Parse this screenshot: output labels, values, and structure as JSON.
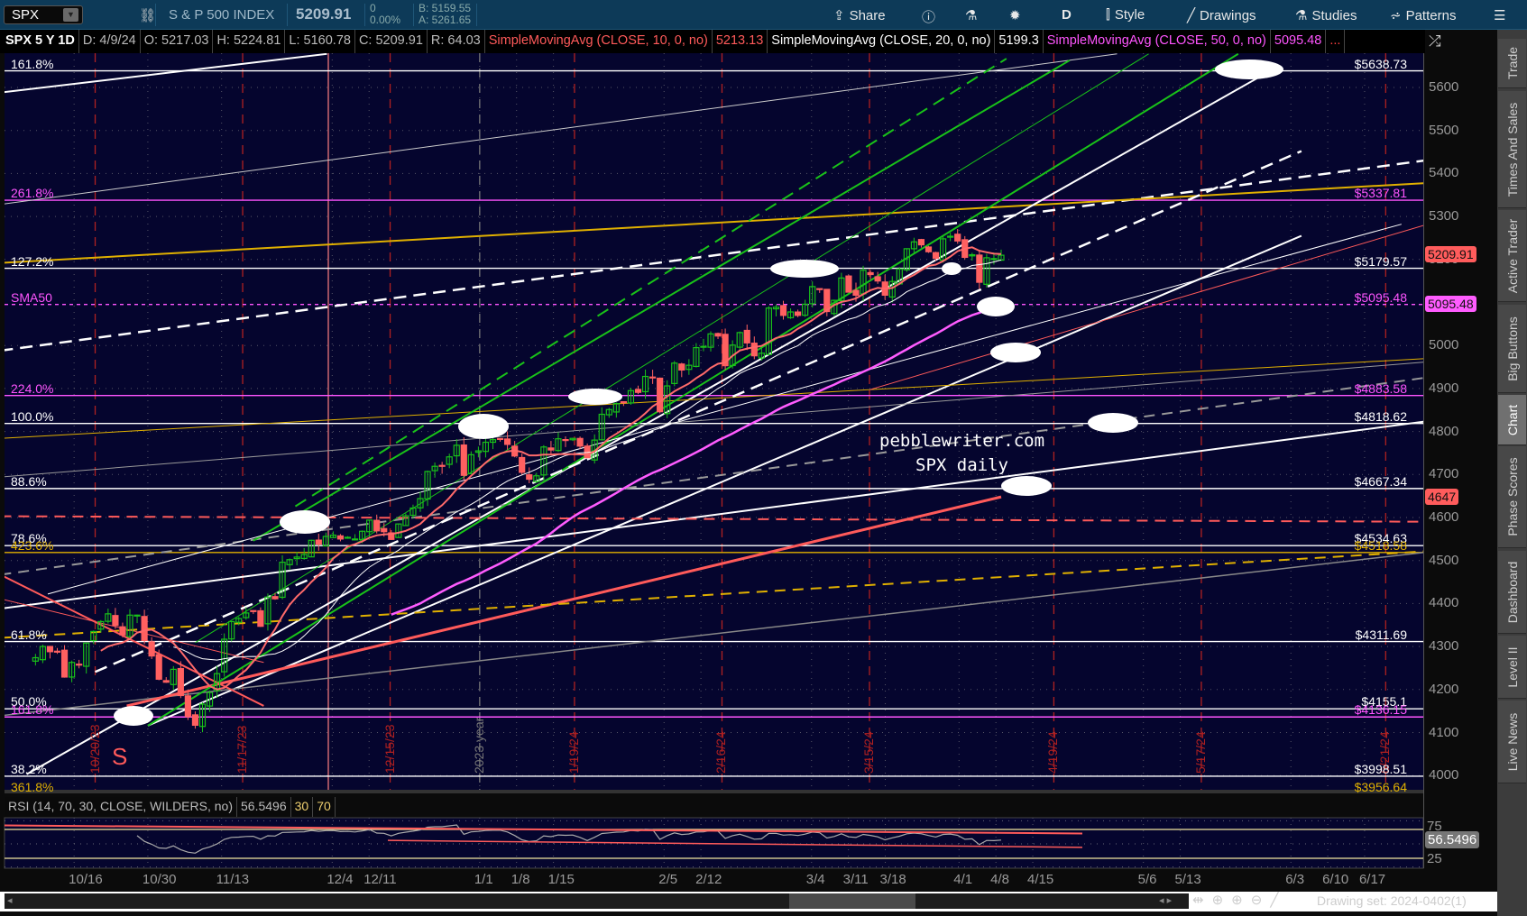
{
  "toolbar": {
    "symbol": "SPX",
    "description": "S & P 500 INDEX",
    "last": "5209.91",
    "change": "0",
    "change_pct": "0.00%",
    "bid": "B: 5159.55",
    "ask": "A: 5261.65",
    "share": "Share",
    "period": "D",
    "style": "Style",
    "drawings": "Drawings",
    "studies": "Studies",
    "patterns": "Patterns"
  },
  "info": {
    "title": "SPX 5 Y 1D",
    "date": "D: 4/9/24",
    "open": "O: 5217.03",
    "high": "H: 5224.81",
    "low": "L: 5160.78",
    "close": "C: 5209.91",
    "range": "R: 64.03",
    "sma10_label": "SimpleMovingAvg (CLOSE, 10, 0, no)",
    "sma10_value": "5213.13",
    "sma20_label": "SimpleMovingAvg (CLOSE, 20, 0, no)",
    "sma20_value": "5199.3",
    "sma50_label": "SimpleMovingAvg (CLOSE, 50, 0, no)",
    "sma50_value": "5095.48",
    "more": "..."
  },
  "colors": {
    "background": "#05052e",
    "up": "#19c219",
    "down": "#ff6060",
    "sma10": "#ff6a6a",
    "sma20": "#ffffff",
    "sma50": "#ff5cff",
    "fib_white": "#ffffff",
    "fib_magenta": "#ff55ff",
    "fib_gold": "#e0b000"
  },
  "price_axis": {
    "ticks": [
      5600,
      5500,
      5400,
      5300,
      5200,
      5000,
      4900,
      4800,
      4700,
      4600,
      4500,
      4400,
      4300,
      4200,
      4100,
      4000
    ],
    "last_tag": "5209.91",
    "sma50_tag": "5095.48",
    "line_tag": "4647"
  },
  "fib_levels": [
    {
      "left": "161.8%",
      "right": "$5638.73",
      "price": 5638.73,
      "color": "#ffffff"
    },
    {
      "left": "261.8%",
      "right": "$5337.81",
      "price": 5337.81,
      "color": "#ff55ff"
    },
    {
      "left": "127.2%",
      "right": "$5179.57",
      "price": 5179.57,
      "color": "#ffffff"
    },
    {
      "left": "SMA50",
      "right": "$5095.48",
      "price": 5095.48,
      "color": "#ff55ff",
      "dashed": true
    },
    {
      "left": "224.0%",
      "right": "$4883.58",
      "price": 4883.58,
      "color": "#ff55ff"
    },
    {
      "left": "100.0%",
      "right": "$4818.62",
      "price": 4818.62,
      "color": "#ffffff"
    },
    {
      "left": "88.6%",
      "right": "$4667.34",
      "price": 4667.34,
      "color": "#ffffff"
    },
    {
      "left": "78.6%",
      "right": "$4534.63",
      "price": 4534.63,
      "color": "#ffffff"
    },
    {
      "left": "423.6%",
      "right": "$4518.58",
      "price": 4518.58,
      "color": "#e0b000"
    },
    {
      "left": "61.8%",
      "right": "$4311.69",
      "price": 4311.69,
      "color": "#ffffff"
    },
    {
      "left": "50.0%",
      "right": "$4155.1",
      "price": 4155.1,
      "color": "#ffffff"
    },
    {
      "left": "161.8%",
      "right": "$4136.15",
      "price": 4136.15,
      "color": "#ff55ff"
    },
    {
      "left": "38.2%",
      "right": "$3998.51",
      "price": 3998.51,
      "color": "#ffffff"
    },
    {
      "left": "361.8%",
      "right": "$3956.64",
      "price": 3956.64,
      "color": "#e0b000"
    }
  ],
  "date_axis": [
    [
      "10/16",
      "2023-10-16"
    ],
    [
      "10/30",
      "2023-10-30"
    ],
    [
      "11/13",
      "2023-11-13"
    ],
    [
      "12/4",
      "2023-12-04"
    ],
    [
      "12/11",
      "2023-12-11"
    ],
    [
      "1/1",
      "2024-01-01"
    ],
    [
      "1/8",
      "2024-01-08"
    ],
    [
      "1/15",
      "2024-01-15"
    ],
    [
      "2/5",
      "2024-02-05"
    ],
    [
      "2/12",
      "2024-02-12"
    ],
    [
      "3/4",
      "2024-03-04"
    ],
    [
      "3/11",
      "2024-03-11"
    ],
    [
      "3/18",
      "2024-03-18"
    ],
    [
      "4/1",
      "2024-04-01"
    ],
    [
      "4/8",
      "2024-04-08"
    ],
    [
      "4/15",
      "2024-04-15"
    ],
    [
      "5/6",
      "2024-05-06"
    ],
    [
      "5/13",
      "2024-05-13"
    ],
    [
      "6/3",
      "2024-06-03"
    ],
    [
      "6/10",
      "2024-06-10"
    ],
    [
      "6/17",
      "2024-06-17"
    ]
  ],
  "date_markers": [
    [
      "10/20/23",
      "2023-10-20",
      "#b02020"
    ],
    [
      "11/17/23",
      "2023-11-17",
      "#b02020"
    ],
    [
      "12/15/23",
      "2023-12-15",
      "#b02020"
    ],
    [
      "2023 year",
      "2024-01-01",
      "#777777"
    ],
    [
      "1/19/24",
      "2024-01-19",
      "#b02020"
    ],
    [
      "2/16/24",
      "2024-02-16",
      "#b02020"
    ],
    [
      "3/15/24",
      "2024-03-15",
      "#b02020"
    ],
    [
      "4/19/24",
      "2024-04-19",
      "#b02020"
    ],
    [
      "5/17/24",
      "2024-05-17",
      "#b02020"
    ],
    [
      "6/21/24",
      "2024-06-21",
      "#b02020"
    ]
  ],
  "chart_data": {
    "type": "candlestick",
    "symbol": "SPX",
    "timeframe": "daily",
    "first_date": "2023-09-27",
    "last_date": "2024-04-09",
    "closes": [
      4274,
      4300,
      4288,
      4288,
      4229,
      4263,
      4258,
      4308,
      4335,
      4358,
      4376,
      4349,
      4327,
      4373,
      4373,
      4314,
      4278,
      4224,
      4217,
      4247,
      4186,
      4137,
      4117,
      4166,
      4193,
      4237,
      4317,
      4358,
      4365,
      4378,
      4382,
      4347,
      4415,
      4411,
      4496,
      4502,
      4508,
      4514,
      4547,
      4538,
      4556,
      4559,
      4550,
      4554,
      4550,
      4568,
      4594,
      4569,
      4567,
      4549,
      4585,
      4604,
      4622,
      4644,
      4707,
      4719,
      4719,
      4741,
      4768,
      4698,
      4746,
      4755,
      4775,
      4781,
      4783,
      4770,
      4743,
      4705,
      4689,
      4697,
      4764,
      4757,
      4783,
      4780,
      4784,
      4766,
      4739,
      4780,
      4840,
      4851,
      4865,
      4869,
      4895,
      4891,
      4928,
      4925,
      4846,
      4906,
      4959,
      4943,
      4954,
      4995,
      4998,
      5027,
      5022,
      4953,
      5001,
      5030,
      5006,
      4976,
      4982,
      5087,
      5089,
      5070,
      5078,
      5070,
      5096,
      5137,
      5131,
      5079,
      5105,
      5157,
      5124,
      5117,
      5175,
      5165,
      5150,
      5117,
      5149,
      5178,
      5225,
      5241,
      5234,
      5218,
      5203,
      5248,
      5254,
      5243,
      5205,
      5211,
      5147,
      5204,
      5202,
      5209.91
    ],
    "studies": [
      {
        "name": "SimpleMovingAvg (CLOSE, 10, 0, no)",
        "length": 10
      },
      {
        "name": "SimpleMovingAvg (CLOSE, 20, 0, no)",
        "length": 20
      },
      {
        "name": "SimpleMovingAvg (CLOSE, 50, 0, no)",
        "length": 50
      }
    ],
    "trendlines": [
      {
        "from": [
          "2023-10-02",
          5588
        ],
        "to": [
          "2023-12-03",
          5678
        ],
        "color": "#ffffff",
        "w": 2
      },
      {
        "from": [
          "2023-10-02",
          5328
        ],
        "to": [
          "2024-05-01",
          5678
        ],
        "color": "#cccccc",
        "w": 1
      },
      {
        "from": [
          "2023-10-02",
          4988
        ],
        "to": [
          "2024-07-02",
          5436
        ],
        "color": "#ffffff",
        "w": 2.5,
        "dash": "14 8"
      },
      {
        "from": [
          "2023-10-02",
          5192
        ],
        "to": [
          "2024-07-02",
          5380
        ],
        "color": "#e0b000",
        "w": 2
      },
      {
        "from": [
          "2023-10-07",
          4003
        ],
        "to": [
          "2024-05-31",
          5645
        ],
        "color": "#ffffff",
        "w": 2
      },
      {
        "from": [
          "2023-10-30",
          4116
        ],
        "to": [
          "2024-06-05",
          5255
        ],
        "color": "#ffffff",
        "w": 2
      },
      {
        "from": [
          "2023-10-02",
          4388
        ],
        "to": [
          "2024-07-02",
          4829
        ],
        "color": "#ffffff",
        "w": 2
      },
      {
        "from": [
          "2023-10-02",
          4467
        ],
        "to": [
          "2024-07-02",
          4931
        ],
        "color": "#999999",
        "w": 2,
        "dash": "12 8"
      },
      {
        "from": [
          "2023-10-02",
          4694
        ],
        "to": [
          "2024-07-02",
          4965
        ],
        "color": "#999999",
        "w": 1
      },
      {
        "from": [
          "2023-10-02",
          4139
        ],
        "to": [
          "2024-07-02",
          4524
        ],
        "color": "#888888",
        "w": 1.5
      },
      {
        "from": [
          "2023-10-26",
          4162
        ],
        "to": [
          "2024-04-09",
          4648
        ],
        "color": "#ff5a5a",
        "w": 3
      },
      {
        "from": [
          "2023-10-02",
          4603
        ],
        "to": [
          "2024-07-02",
          4590
        ],
        "color": "#ff5a5a",
        "w": 2,
        "dash": "12 8"
      },
      {
        "from": [
          "2023-10-02",
          4320
        ],
        "to": [
          "2024-07-02",
          4524
        ],
        "color": "#e0b000",
        "w": 2,
        "dash": "12 8"
      },
      {
        "from": [
          "2023-10-02",
          4784
        ],
        "to": [
          "2024-07-02",
          4972
        ],
        "color": "#e0b000",
        "w": 1
      },
      {
        "from": [
          "2023-10-30",
          4116
        ],
        "to": [
          "2024-05-24",
          5678
        ],
        "color": "#19c219",
        "w": 2
      },
      {
        "from": [
          "2023-11-08",
          4309
        ],
        "to": [
          "2024-05-07",
          5678
        ],
        "color": "#19c219",
        "w": 1
      },
      {
        "from": [
          "2023-11-19",
          4546
        ],
        "to": [
          "2024-04-22",
          5663
        ],
        "color": "#19c219",
        "w": 2
      },
      {
        "from": [
          "2023-11-27",
          4626
        ],
        "to": [
          "2024-04-10",
          5667
        ],
        "color": "#19c219",
        "w": 2,
        "dash": "14 8"
      },
      {
        "from": [
          "2023-10-20",
          4241
        ],
        "to": [
          "2024-06-05",
          5452
        ],
        "color": "#ffffff",
        "w": 2.5,
        "dash": "14 8"
      },
      {
        "from": [
          "2023-10-11",
          4422
        ],
        "to": [
          "2024-06-24",
          5282
        ],
        "color": "#ffffff",
        "w": 1
      },
      {
        "from": [
          "2024-03-15",
          4897
        ],
        "to": [
          "2024-07-02",
          5293
        ],
        "color": "#ff5a5a",
        "w": 1
      },
      {
        "from": [
          "2023-10-02",
          4467
        ],
        "to": [
          "2023-11-21",
          4162
        ],
        "color": "#ff5a5a",
        "w": 2
      },
      {
        "from": [
          "2023-10-02",
          4411
        ],
        "to": [
          "2023-11-21",
          4263
        ],
        "color": "#ff5a5a",
        "w": 1
      }
    ]
  },
  "rsi": {
    "label": "RSI (14, 70, 30, CLOSE, WILDERS, no)",
    "value": "56.5496",
    "os": "30",
    "ob": "70",
    "tick_75": "75",
    "tick_25": "25",
    "length": 14
  },
  "annotations": {
    "site": "pebblewriter.com",
    "subtitle": "SPX daily",
    "marker": "S"
  },
  "sidebar": [
    "Trade",
    "Times And Sales",
    "Active Trader",
    "Big Buttons",
    "Chart",
    "Phase Scores",
    "Dashboard",
    "Level II",
    "Live News"
  ],
  "footer": {
    "drawing_set": "Drawing set: 2024-0402(1)"
  }
}
